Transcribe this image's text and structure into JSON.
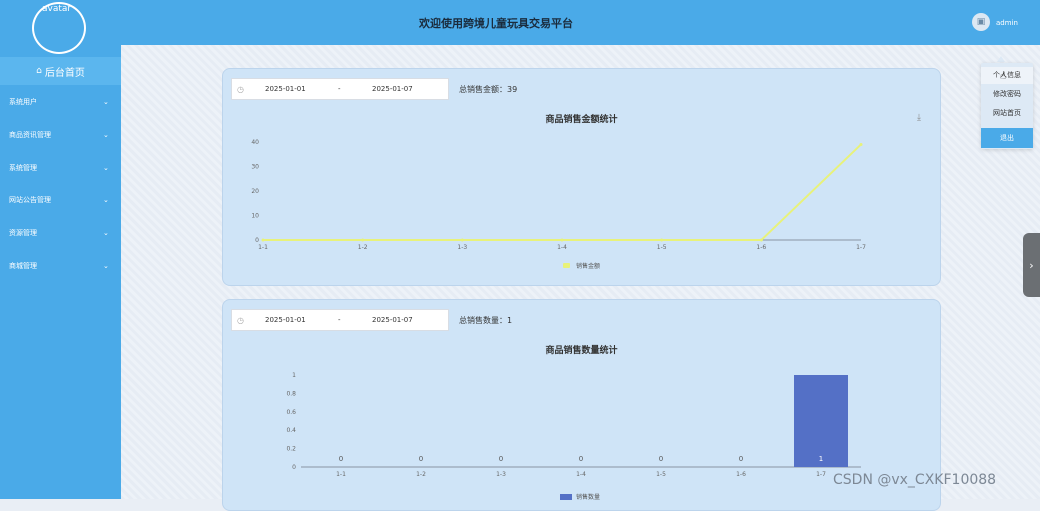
{
  "sidebar": {
    "avatar_label": "avatar",
    "home_label": "后台首页",
    "items": [
      {
        "label": "系统用户"
      },
      {
        "label": "商品资讯管理"
      },
      {
        "label": "系统管理"
      },
      {
        "label": "网站公告管理"
      },
      {
        "label": "资源管理"
      },
      {
        "label": "商城管理"
      }
    ]
  },
  "header": {
    "title": "欢迎使用跨境儿童玩具交易平台",
    "user_name": "admin"
  },
  "user_menu": {
    "items": [
      "个人信息",
      "修改密码",
      "网站首页"
    ],
    "logout": "退出"
  },
  "panel1": {
    "start_date": "2025-01-01",
    "end_date": "2025-01-07",
    "separator": "-",
    "total_label": "总销售金额：39",
    "chart_data": {
      "type": "line",
      "title": "商品销售金额统计",
      "categories": [
        "1-1",
        "1-2",
        "1-3",
        "1-4",
        "1-5",
        "1-6",
        "1-7"
      ],
      "series": [
        {
          "name": "销售金额",
          "values": [
            0,
            0,
            0,
            0,
            0,
            0,
            39
          ],
          "color": "#e8f27a"
        }
      ],
      "yticks": [
        0,
        10,
        20,
        30,
        40
      ],
      "ylim": [
        0,
        40
      ],
      "legend_position": "bottom"
    }
  },
  "panel2": {
    "start_date": "2025-01-01",
    "end_date": "2025-01-07",
    "separator": "-",
    "total_label": "总销售数量：1",
    "chart_data": {
      "type": "bar",
      "title": "商品销售数量统计",
      "categories": [
        "1-1",
        "1-2",
        "1-3",
        "1-4",
        "1-5",
        "1-6",
        "1-7"
      ],
      "series": [
        {
          "name": "销售数量",
          "values": [
            0,
            0,
            0,
            0,
            0,
            0,
            1
          ],
          "color": "#5470c6"
        }
      ],
      "yticks": [
        "0",
        "0.2",
        "0.4",
        "0.6",
        "0.8",
        "1"
      ],
      "ylim": [
        0,
        1
      ],
      "legend_position": "bottom"
    }
  },
  "watermark": "CSDN @vx_CXKF10088"
}
